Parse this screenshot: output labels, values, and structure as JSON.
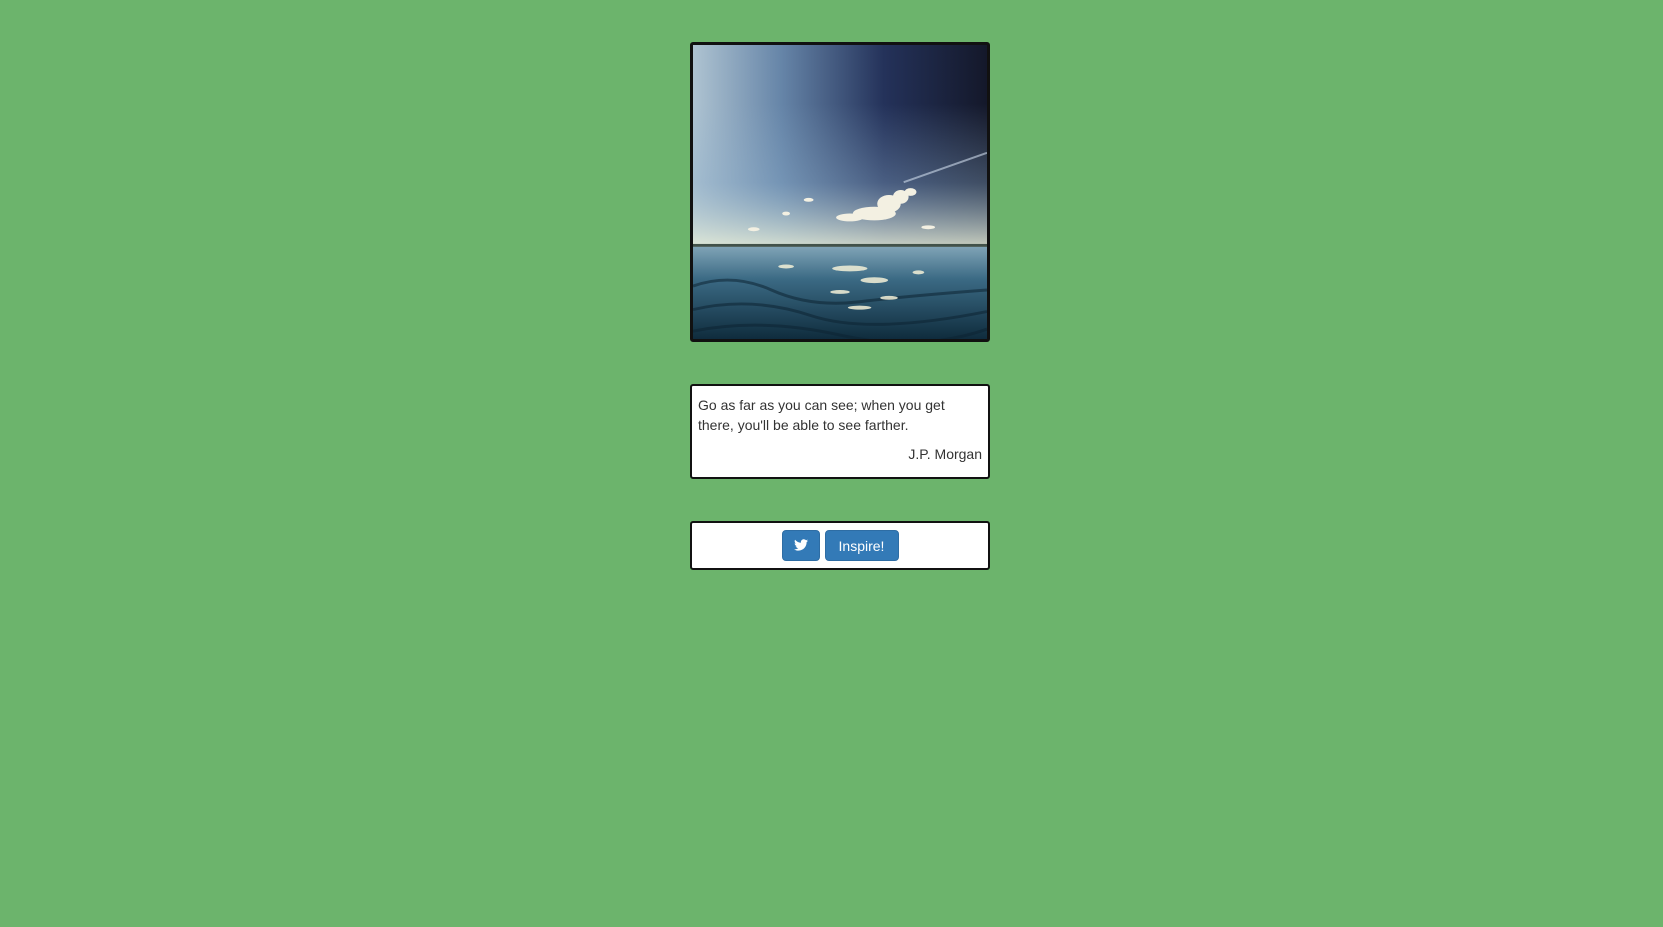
{
  "image": {
    "alt": "sky and sea"
  },
  "quote": {
    "text": "Go as far as you can see; when you get there, you'll be able to see farther.",
    "author": "J.P. Morgan"
  },
  "actions": {
    "tweet_icon": "twitter-icon",
    "inspire_label": "Inspire!"
  },
  "colors": {
    "background": "#6cb46c",
    "button": "#337ab7",
    "border": "#111111"
  }
}
